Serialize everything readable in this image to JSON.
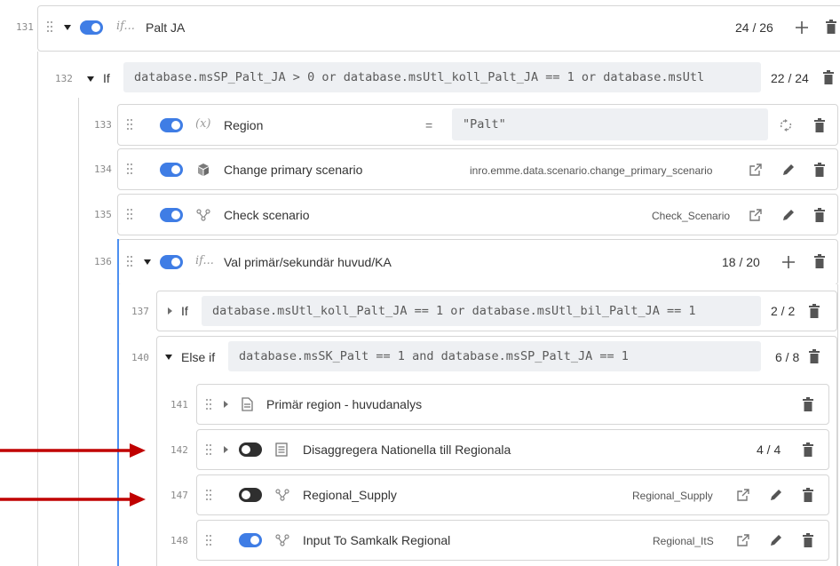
{
  "rows": {
    "r131": {
      "num": "131",
      "label": "Palt JA",
      "ifx": "if...",
      "count": "24 / 26"
    },
    "r132": {
      "num": "132",
      "label": "If",
      "condition": "database.msSP_Palt_JA > 0 or database.msUtl_koll_Palt_JA == 1 or database.msUtl",
      "count": "22 / 24"
    },
    "r133": {
      "num": "133",
      "var": "(x)",
      "label": "Region",
      "op": "=",
      "value": "\"Palt\""
    },
    "r134": {
      "num": "134",
      "label": "Change primary scenario",
      "target": "inro.emme.data.scenario.change_primary_scenario"
    },
    "r135": {
      "num": "135",
      "label": "Check scenario",
      "target": "Check_Scenario"
    },
    "r136": {
      "num": "136",
      "label": "Val primär/sekundär huvud/KA",
      "ifx": "if...",
      "count": "18 / 20"
    },
    "r137": {
      "num": "137",
      "label": "If",
      "condition": "database.msUtl_koll_Palt_JA == 1 or database.msUtl_bil_Palt_JA == 1",
      "count": "2 / 2"
    },
    "r140": {
      "num": "140",
      "label": "Else if",
      "condition": "database.msSK_Palt == 1 and database.msSP_Palt_JA == 1",
      "count": "6 / 8"
    },
    "r141": {
      "num": "141",
      "label": "Primär region - huvudanalys"
    },
    "r142": {
      "num": "142",
      "label": "Disaggregera Nationella till Regionala",
      "count": "4 / 4"
    },
    "r147": {
      "num": "147",
      "label": "Regional_Supply",
      "target": "Regional_Supply"
    },
    "r148": {
      "num": "148",
      "label": "Input To Samkalk Regional",
      "target": "Regional_ItS"
    }
  },
  "colors": {
    "toggle_on": "#3f7de5",
    "toggle_off": "#2f2f2f",
    "arrow": "#c00000",
    "accent_bar": "#4d8ff0"
  }
}
